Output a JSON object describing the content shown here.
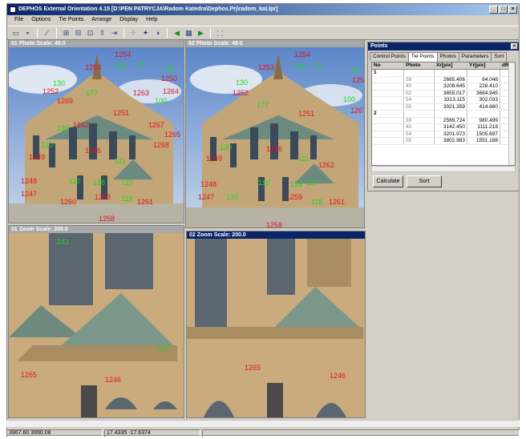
{
  "window": {
    "title": "DEPHOS External Orientation 4.15 [D:\\PEN PATRYCJA\\Radom Katedra\\Dephos.Prj\\radom_kat.lpr]"
  },
  "menu": [
    "File",
    "Options",
    "Tie Points",
    "Arrange",
    "Display",
    "Help"
  ],
  "toolbar_icons": [
    "open-icon",
    "save-icon",
    "wand-icon",
    "grid-a-icon",
    "grid-b-icon",
    "grid-c-icon",
    "export-icon",
    "import-icon",
    "points-icon",
    "tool-icon",
    "contrast-icon",
    "arrow-left-icon",
    "table-icon",
    "arrow-right-icon",
    "select-icon"
  ],
  "viewers": {
    "photo1": {
      "header": "01 Photo Scale:   49.0"
    },
    "photo2": {
      "header": "02 Photo Scale:   49.0"
    },
    "zoom1": {
      "header": "01 Zoom Scale:  200.0"
    },
    "zoom2": {
      "header": "02 Zoom Scale:  200.0"
    }
  },
  "photo_labels_red": [
    "1254",
    "1253",
    "1252",
    "1251",
    "1250",
    "1249",
    "1248",
    "1247",
    "1259",
    "1260",
    "1258",
    "1261",
    "1262",
    "1263",
    "1264",
    "1265",
    "1266",
    "1267",
    "1268",
    "1269"
  ],
  "photo_labels_green": [
    "140",
    "31",
    "130",
    "99",
    "177",
    "100",
    "111",
    "127",
    "128",
    "110",
    "118",
    "120",
    "133"
  ],
  "zoom1_labels": {
    "green_top": "243",
    "green_right": "244",
    "red_left": "1265",
    "red_mid": "1246"
  },
  "zoom2_labels": {
    "red_left": "1265",
    "red_right": "1246"
  },
  "points_panel": {
    "title": "Points",
    "tabs": [
      "Control Points",
      "Tie Points",
      "Photos",
      "Parameters",
      "Sort"
    ],
    "columns": [
      "No",
      "Photo",
      "Xr[pix]",
      "Yr[pix]",
      "dR"
    ],
    "rows": [
      {
        "no": "1",
        "photo": "",
        "xr": "",
        "yr": ""
      },
      {
        "no": "",
        "photo": "39",
        "xr": "2665.406",
        "yr": "84.048"
      },
      {
        "no": "",
        "photo": "40",
        "xr": "3208.645",
        "yr": "228.410"
      },
      {
        "no": "",
        "photo": "52",
        "xr": "3855.017",
        "yr": "3684.945"
      },
      {
        "no": "",
        "photo": "54",
        "xr": "3313.115",
        "yr": "302.033"
      },
      {
        "no": "",
        "photo": "55",
        "xr": "3921.359",
        "yr": "414.660"
      },
      {
        "no": "2",
        "photo": "",
        "xr": "",
        "yr": ""
      },
      {
        "no": "",
        "photo": "39",
        "xr": "2569.724",
        "yr": "980.499"
      },
      {
        "no": "",
        "photo": "40",
        "xr": "3142.450",
        "yr": "1111.218"
      },
      {
        "no": "",
        "photo": "54",
        "xr": "3201.973",
        "yr": "1505.697"
      },
      {
        "no": "",
        "photo": "55",
        "xr": "3802.983",
        "yr": "1551.188"
      }
    ],
    "buttons": {
      "calculate": "Calculate",
      "sort": "Sort"
    }
  },
  "status": {
    "coords_pix": "3967.60  3990.08",
    "coords_world": "17.4335  -17.6374"
  }
}
